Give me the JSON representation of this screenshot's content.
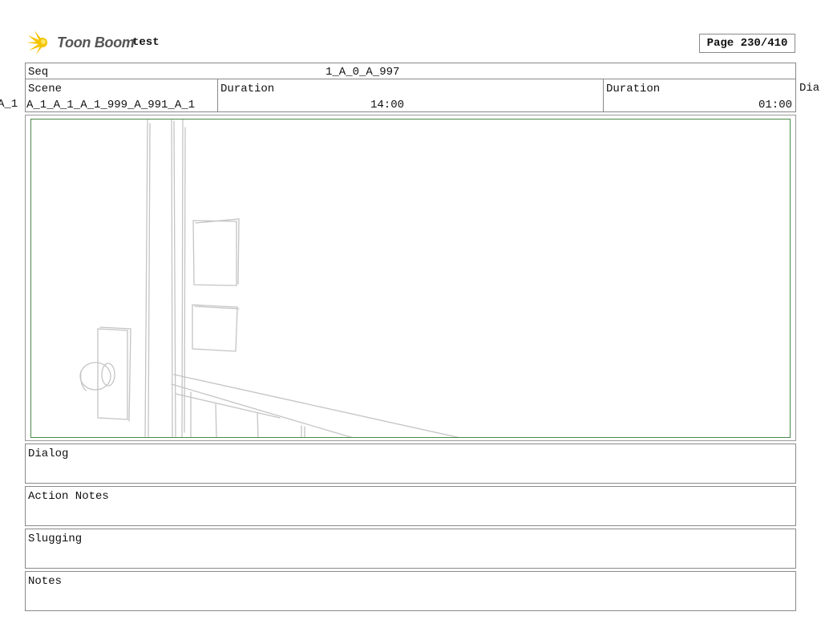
{
  "header": {
    "brand": "Toon Boom",
    "project": "test",
    "page": "Page 230/410"
  },
  "sequence": {
    "label": "Seq",
    "value": "1_A_0_A_997"
  },
  "scene": {
    "label": "Scene",
    "value": "A_1_A_1_A_1_999_A_991_A_1",
    "prev_overflow": "A_1",
    "duration_label": "Duration",
    "duration_value": "14:00",
    "panel_duration_label": "Duration",
    "panel_duration_value": "01:00",
    "next_overflow": "Dia"
  },
  "panels": {
    "dialog": "Dialog",
    "action_notes": "Action Notes",
    "slugging": "Slugging",
    "notes": "Notes"
  },
  "colors": {
    "frame_border": "#4a8a4a",
    "sketch_stroke": "#bdbdbd",
    "logo_star": "#f5c400"
  }
}
